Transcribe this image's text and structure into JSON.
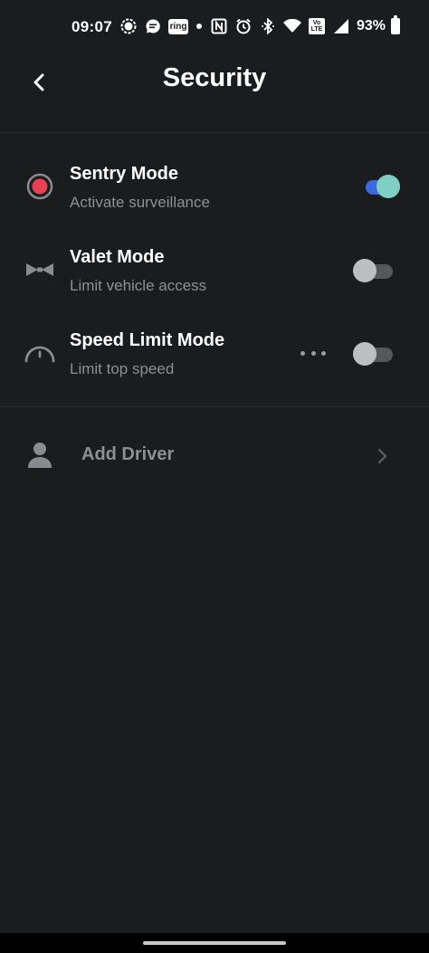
{
  "status_bar": {
    "time": "09:07",
    "ring_badge": "ring",
    "volte_label": "Vo LTE",
    "battery_percent": "93%",
    "icons": [
      "signal-messenger-icon",
      "messaging-icon",
      "ring-app-icon",
      "dot-icon",
      "nfc-icon",
      "alarm-icon",
      "bluetooth-icon",
      "wifi-icon",
      "volte-icon",
      "cellular-signal-icon",
      "battery-icon"
    ]
  },
  "header": {
    "title": "Security",
    "back_icon": "chevron-left-icon"
  },
  "settings": [
    {
      "title": "Sentry Mode",
      "subtitle": "Activate surveillance",
      "icon": "sentry-record-icon",
      "enabled": true,
      "accent": "#e84152"
    },
    {
      "title": "Valet Mode",
      "subtitle": "Limit vehicle access",
      "icon": "bowtie-icon",
      "enabled": false
    },
    {
      "title": "Speed Limit Mode",
      "subtitle": "Limit top speed",
      "icon": "speedometer-icon",
      "enabled": false,
      "has_more_menu": true
    }
  ],
  "add_driver": {
    "label": "Add Driver",
    "icon": "person-icon",
    "chevron": "chevron-right-icon"
  },
  "colors": {
    "background": "#1b1c1e",
    "toggle_on_track": "#3e6ae1",
    "toggle_on_knob": "#7ed0c2",
    "toggle_off_track": "#55575b",
    "toggle_off_knob": "#bdbebf",
    "secondary_text": "#8e8f93"
  }
}
